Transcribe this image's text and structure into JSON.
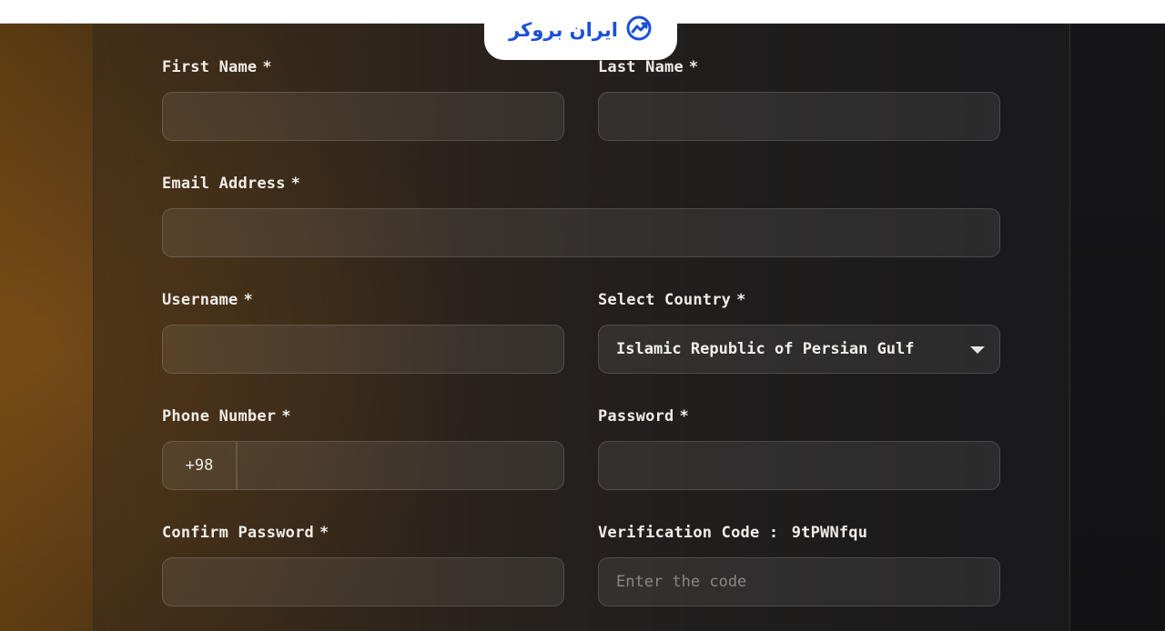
{
  "brand": {
    "logo_text": "ایران بروکر",
    "accent": "#1b4fd8"
  },
  "form": {
    "first_name": {
      "label": "First Name",
      "required": "*",
      "value": ""
    },
    "last_name": {
      "label": "Last Name",
      "required": "*",
      "value": ""
    },
    "email": {
      "label": "Email Address",
      "required": "*",
      "value": ""
    },
    "username": {
      "label": "Username",
      "required": "*",
      "value": ""
    },
    "country": {
      "label": "Select Country",
      "required": "*",
      "selected": "Islamic Republic of Persian Gulf"
    },
    "phone": {
      "label": "Phone Number",
      "required": "*",
      "prefix": "+98",
      "value": ""
    },
    "password": {
      "label": "Password",
      "required": "*",
      "value": ""
    },
    "confirm_password": {
      "label": "Confirm Password",
      "required": "*",
      "value": ""
    },
    "verification": {
      "label": "Verification Code :",
      "code": "9tPWNfqu",
      "placeholder": "Enter the code",
      "value": ""
    }
  }
}
